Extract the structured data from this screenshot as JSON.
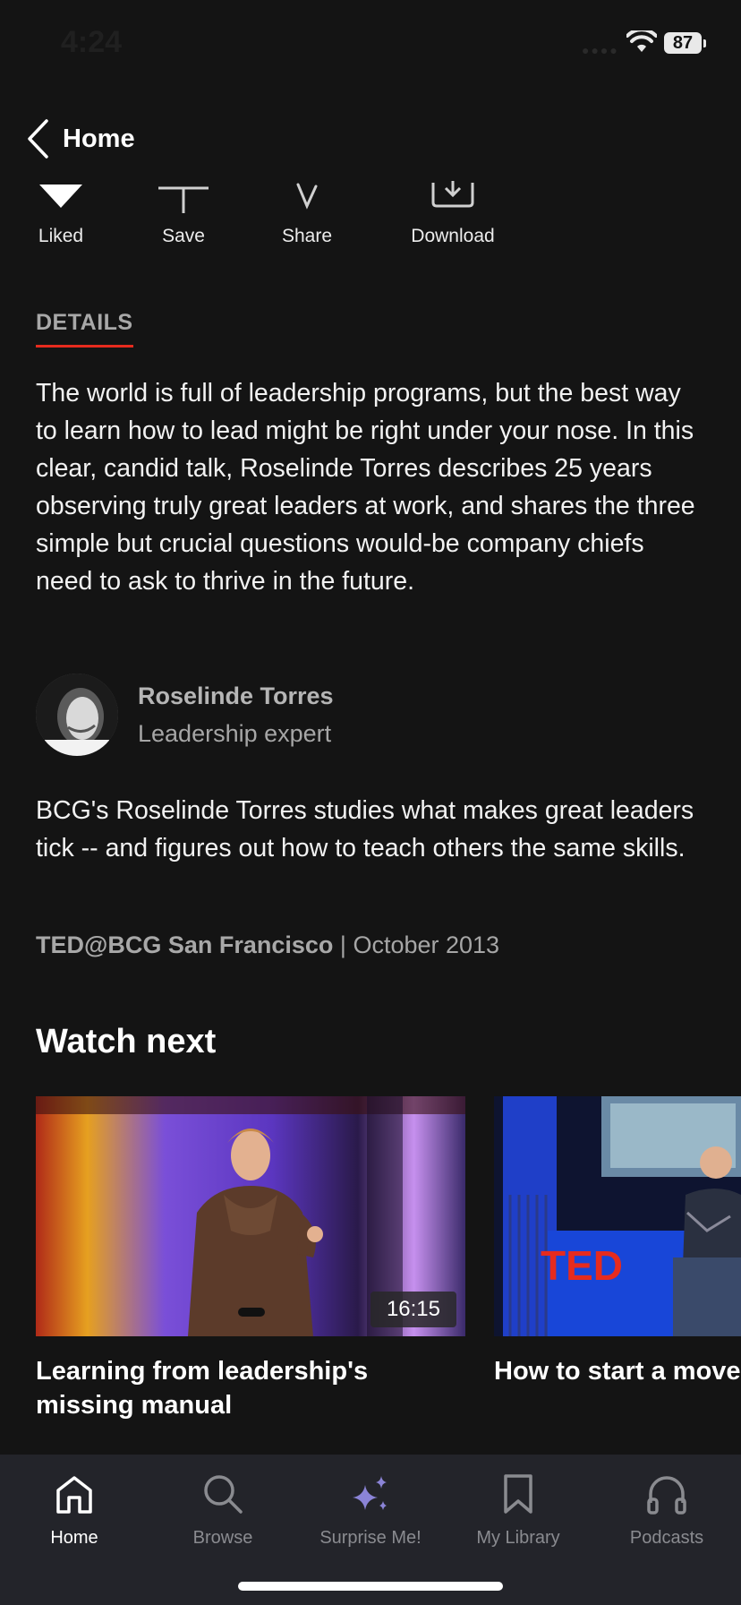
{
  "status_bar": {
    "time": "4:24",
    "battery": "87"
  },
  "nav": {
    "back_label": "Home"
  },
  "actions": [
    {
      "label": "Liked",
      "icon": "heart-icon"
    },
    {
      "label": "Save",
      "icon": "plus-icon"
    },
    {
      "label": "Share",
      "icon": "share-icon"
    },
    {
      "label": "Download",
      "icon": "download-icon"
    }
  ],
  "details": {
    "tab_label": "DETAILS",
    "description": "The world is full of leadership programs, but the best way to learn how to lead might be right under your nose. In this clear, candid talk, Roselinde Torres describes 25 years observing truly great leaders at work, and shares the three simple but crucial questions would-be company chiefs need to ask to thrive in the future."
  },
  "speaker": {
    "name": "Roselinde Torres",
    "title": "Leadership expert",
    "bio": "BCG's Roselinde Torres studies what makes great leaders tick -- and figures out how to teach others the same skills."
  },
  "event": {
    "name": "TED@BCG San Francisco",
    "separator": " | ",
    "date": "October 2013"
  },
  "watch_next": {
    "title": "Watch next",
    "items": [
      {
        "title": "Learning from leadership's missing manual",
        "duration": "16:15"
      },
      {
        "title": "How to start a movement",
        "duration": ""
      }
    ],
    "ted_logo_text": "TED"
  },
  "tabbar": {
    "items": [
      {
        "label": "Home",
        "icon": "home-icon",
        "active": true
      },
      {
        "label": "Browse",
        "icon": "search-icon",
        "active": false
      },
      {
        "label": "Surprise Me!",
        "icon": "sparkle-icon",
        "active": false
      },
      {
        "label": "My Library",
        "icon": "bookmark-icon",
        "active": false
      },
      {
        "label": "Podcasts",
        "icon": "headphones-icon",
        "active": false
      }
    ]
  },
  "colors": {
    "background": "#141414",
    "accent": "#e62b1e",
    "tabbar": "#23242a",
    "surprise": "#8b84d7"
  }
}
